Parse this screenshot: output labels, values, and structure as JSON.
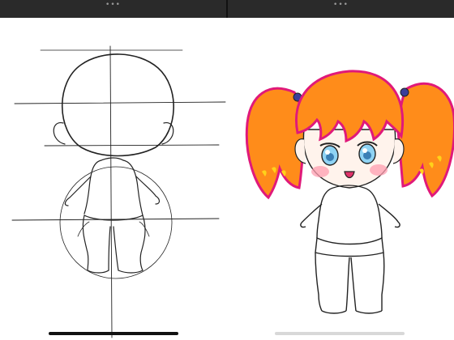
{
  "window": {
    "left_handle": "•••",
    "right_handle": "•••"
  },
  "panes": {
    "left": {
      "content": "pencil-sketch-chibi-figure"
    },
    "right": {
      "content": "colored-chibi-girl-drawing"
    }
  },
  "colors": {
    "hair": "#ff8c1a",
    "hair_outline": "#e0197a",
    "eyes": "#8fd3f4",
    "blush": "#ff9db0",
    "sketch_line": "#222222"
  }
}
